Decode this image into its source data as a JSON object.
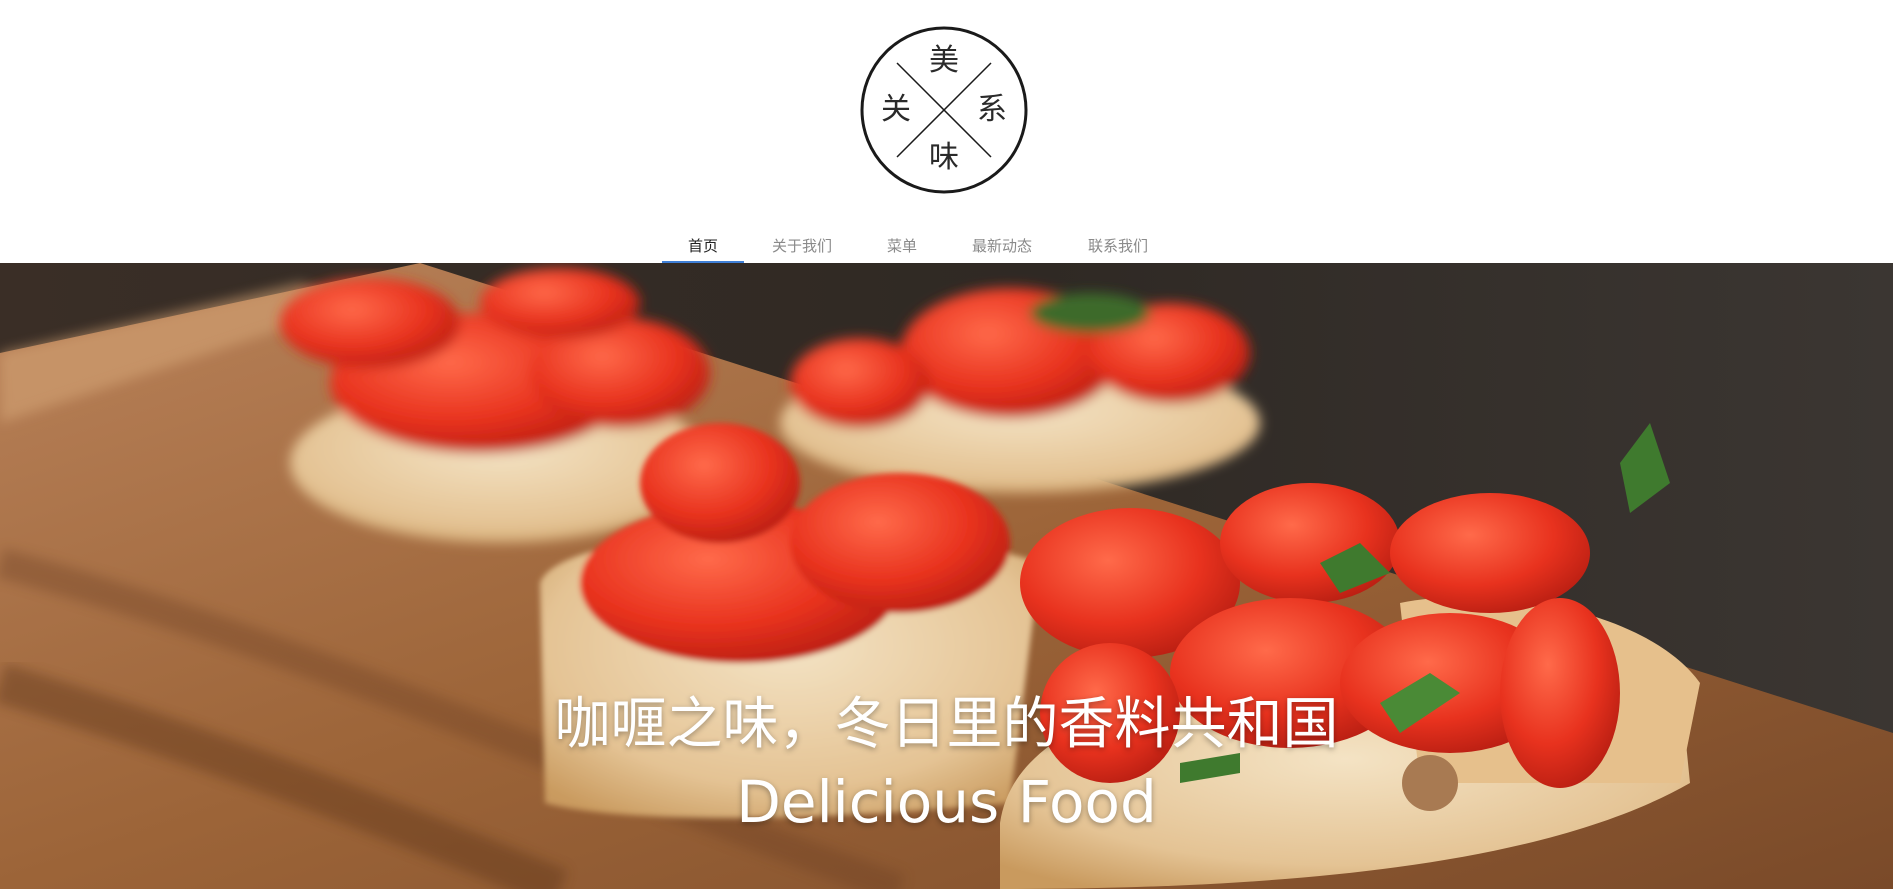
{
  "logo": {
    "chars": {
      "top": "美",
      "left": "关",
      "right": "系",
      "bottom": "味"
    }
  },
  "nav": {
    "items": [
      {
        "label": "首页",
        "active": true
      },
      {
        "label": "关于我们",
        "active": false
      },
      {
        "label": "菜单",
        "active": false
      },
      {
        "label": "最新动态",
        "active": false
      },
      {
        "label": "联系我们",
        "active": false
      }
    ],
    "active_color": "#3f7fd6"
  },
  "hero": {
    "title_cn": "咖喱之味，冬日里的香料共和国",
    "title_en": "Delicious Food"
  }
}
